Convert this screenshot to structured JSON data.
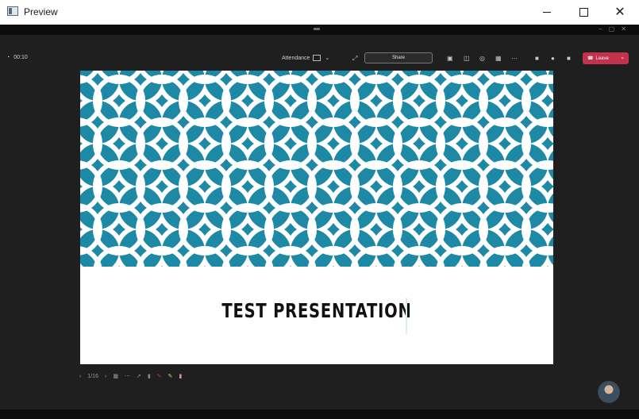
{
  "window": {
    "title": "Preview"
  },
  "toolbar": {
    "timer": "00:10",
    "status_text": "Attendance",
    "pill_label": "Share",
    "leave_label": "Leave"
  },
  "slide": {
    "title": "TEST PRESENTATION",
    "pattern_color": "#1d89a4"
  },
  "bottom_bar": {
    "page_indicator": "1/16"
  },
  "colors": {
    "leave": "#c4314b",
    "background": "#1f1f1f"
  }
}
